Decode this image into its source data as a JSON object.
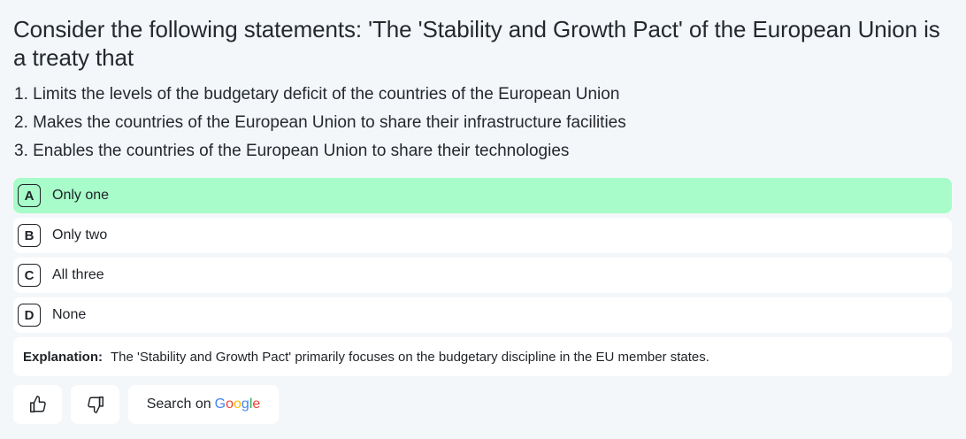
{
  "question": {
    "text": "Consider the following statements: 'The 'Stability and Growth Pact' of the European Union is a treaty that"
  },
  "statements": [
    "1. Limits the levels of the budgetary deficit of the countries of the European Union",
    "2. Makes the countries of the European Union to share their infrastructure facilities",
    "3. Enables the countries of the European Union to share their technologies"
  ],
  "options": [
    {
      "letter": "A",
      "text": "Only one",
      "correct": true
    },
    {
      "letter": "B",
      "text": "Only two",
      "correct": false
    },
    {
      "letter": "C",
      "text": "All three",
      "correct": false
    },
    {
      "letter": "D",
      "text": "None",
      "correct": false
    }
  ],
  "explanation": {
    "label": "Explanation:",
    "text": "The 'Stability and Growth Pact' primarily focuses on the budgetary discipline in the EU member states."
  },
  "actions": {
    "thumbs_up_icon": "thumbs-up-icon",
    "thumbs_down_icon": "thumbs-down-icon",
    "search_label": "Search on",
    "google_letters": [
      "G",
      "o",
      "o",
      "g",
      "l",
      "e"
    ]
  },
  "colors": {
    "correct_option_bg": "#a7fcc9",
    "page_bg": "#f4f7fa",
    "google_blue": "#4285f4",
    "google_red": "#ea4335",
    "google_yellow": "#fbbc05",
    "google_green": "#34a853"
  }
}
